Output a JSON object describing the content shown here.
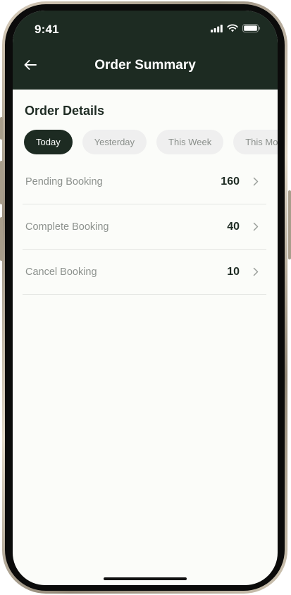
{
  "status_bar": {
    "time": "9:41",
    "icons": [
      "signal-icon",
      "wifi-icon",
      "battery-icon"
    ]
  },
  "header": {
    "back_icon": "arrow-left-icon",
    "title": "Order Summary",
    "background": "#1d2b22"
  },
  "order_details": {
    "title": "Order Details",
    "tabs": [
      {
        "label": "Today",
        "active": true
      },
      {
        "label": "Yesterday",
        "active": false
      },
      {
        "label": "This Week",
        "active": false
      },
      {
        "label": "This Month",
        "active": false
      }
    ],
    "rows": [
      {
        "label": "Pending Booking",
        "value": "160"
      },
      {
        "label": "Complete Booking",
        "value": "40"
      },
      {
        "label": "Cancel Booking",
        "value": "10"
      }
    ]
  },
  "colors": {
    "accent": "#1d2b22",
    "screen_background": "#fbfcf9",
    "muted_text": "#8d928e"
  }
}
